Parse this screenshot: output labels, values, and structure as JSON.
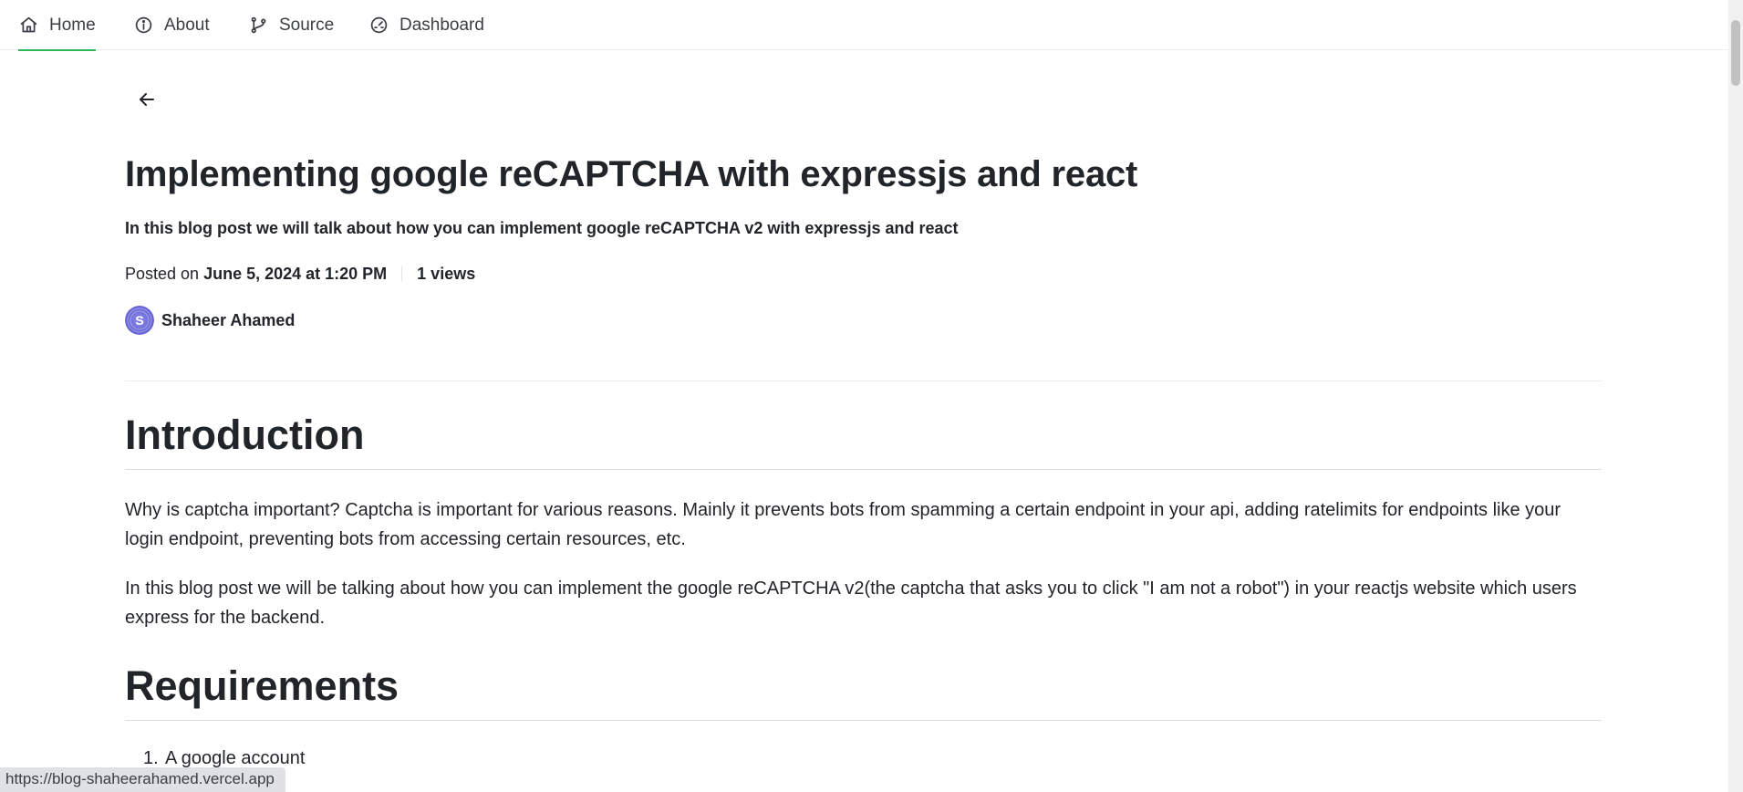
{
  "nav": {
    "items": [
      {
        "label": "Home",
        "icon": "home-icon",
        "active": true
      },
      {
        "label": "About",
        "icon": "info-icon",
        "active": false
      },
      {
        "label": "Source",
        "icon": "git-branch-icon",
        "active": false
      },
      {
        "label": "Dashboard",
        "icon": "gauge-icon",
        "active": false
      }
    ]
  },
  "post": {
    "title": "Implementing google reCAPTCHA with expressjs and react",
    "description": "In this blog post we will talk about how you can implement google reCAPTCHA v2 with expressjs and react",
    "posted_prefix": "Posted on",
    "posted_date": "June 5, 2024 at 1:20 PM",
    "views": "1 views",
    "author": "Shaheer Ahamed",
    "avatar_letter": "S"
  },
  "article": {
    "intro_heading": "Introduction",
    "intro_p1": "Why is captcha important? Captcha is important for various reasons. Mainly it prevents bots from spamming a certain endpoint in your api, adding ratelimits for endpoints like your login endpoint, preventing bots from accessing certain resources, etc.",
    "intro_p2": "In this blog post we will be talking about how you can implement the google reCAPTCHA v2(the captcha that asks you to click \"I am not a robot\") in your reactjs website which users express for the backend.",
    "req_heading": "Requirements",
    "req_items": [
      "A google account"
    ]
  },
  "status_url": "https://blog-shaheerahamed.vercel.app",
  "colors": {
    "accent": "#2fb35b",
    "text": "#212529",
    "avatar": "#6d6bd8"
  }
}
